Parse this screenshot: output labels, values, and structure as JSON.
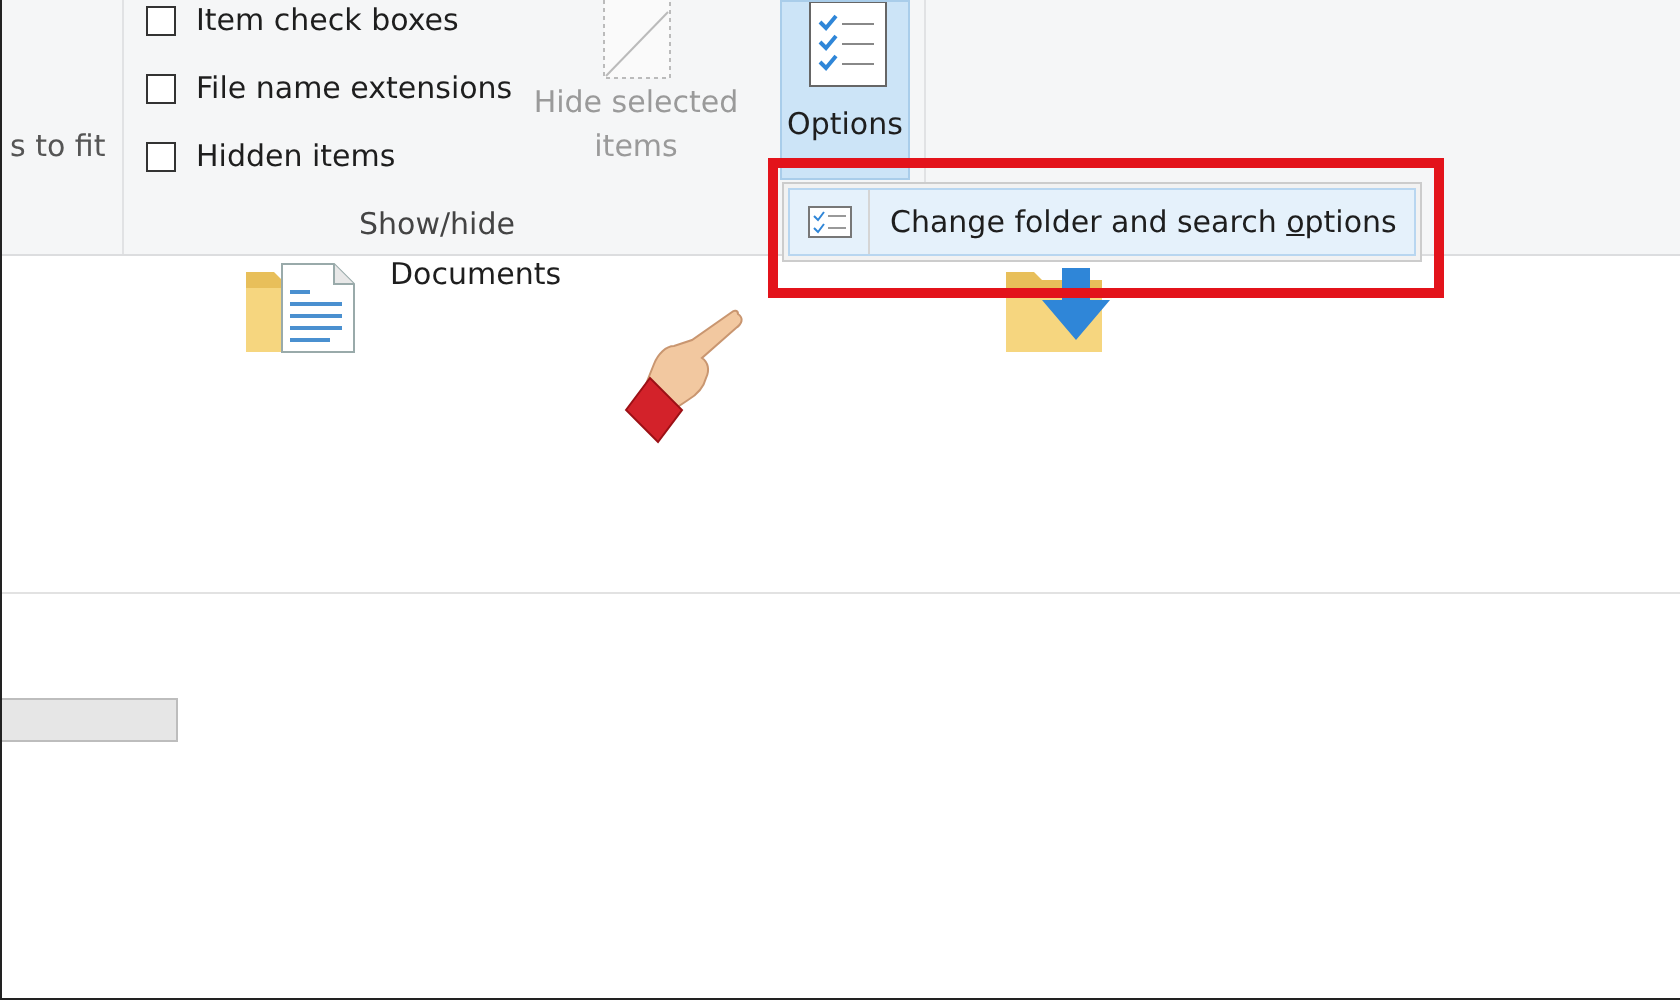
{
  "ribbon": {
    "partial_group": {
      "label": "s to fit"
    },
    "show_hide": {
      "checkboxes": [
        {
          "label": "Item check boxes",
          "checked": false
        },
        {
          "label": "File name extensions",
          "checked": false
        },
        {
          "label": "Hidden items",
          "checked": false
        }
      ],
      "hide_selected": {
        "label": "Hide selected items",
        "disabled": true
      },
      "group_label": "Show/hide"
    },
    "options_button": {
      "label": "Options",
      "selected": true
    }
  },
  "menu": {
    "items": [
      {
        "label_before": "Change folder and search ",
        "access_key": "o",
        "label_after": "ptions",
        "highlighted": true
      }
    ]
  },
  "files": [
    {
      "kind": "documents",
      "name": "Documents"
    },
    {
      "kind": "downloads"
    }
  ]
}
